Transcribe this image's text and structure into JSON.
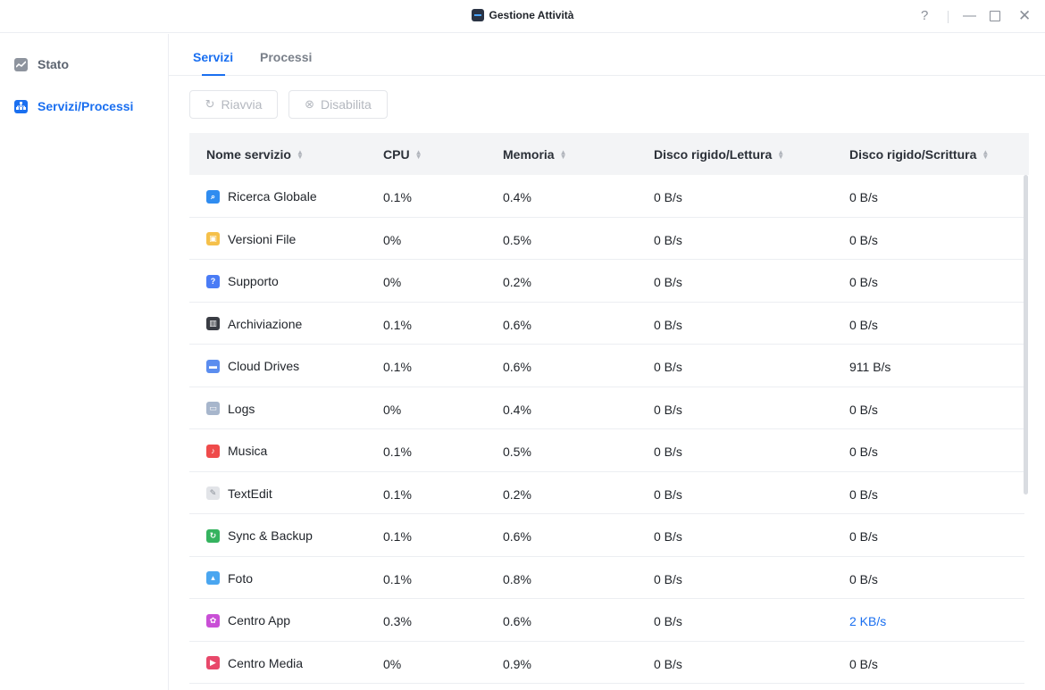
{
  "window": {
    "title": "Gestione Attività",
    "help": "?",
    "minimize": "—",
    "close": "✕"
  },
  "sidebar": {
    "items": [
      {
        "label": "Stato",
        "icon": "chart-line-icon"
      },
      {
        "label": "Servizi/Processi",
        "icon": "hierarchy-icon"
      }
    ]
  },
  "tabs": [
    {
      "label": "Servizi"
    },
    {
      "label": "Processi"
    }
  ],
  "toolbar": {
    "restart_label": "Riavvia",
    "disable_label": "Disabilita"
  },
  "table": {
    "headers": [
      "Nome servizio",
      "CPU",
      "Memoria",
      "Disco rigido/Lettura",
      "Disco rigido/Scrittura"
    ],
    "rows": [
      {
        "name": "Ricerca Globale",
        "cpu": "0.1%",
        "mem": "0.4%",
        "read": "0 B/s",
        "write": "0 B/s",
        "icon": "search-icon",
        "color": "#2f8cf0"
      },
      {
        "name": "Versioni File",
        "cpu": "0%",
        "mem": "0.5%",
        "read": "0 B/s",
        "write": "0 B/s",
        "icon": "file-versions-icon",
        "color": "#f5c04a"
      },
      {
        "name": "Supporto",
        "cpu": "0%",
        "mem": "0.2%",
        "read": "0 B/s",
        "write": "0 B/s",
        "icon": "question-icon",
        "color": "#4a7cf5"
      },
      {
        "name": "Archiviazione",
        "cpu": "0.1%",
        "mem": "0.6%",
        "read": "0 B/s",
        "write": "0 B/s",
        "icon": "storage-icon",
        "color": "#3a3d44"
      },
      {
        "name": "Cloud Drives",
        "cpu": "0.1%",
        "mem": "0.6%",
        "read": "0 B/s",
        "write": "911 B/s",
        "icon": "cloud-drive-icon",
        "color": "#5b8def"
      },
      {
        "name": "Logs",
        "cpu": "0%",
        "mem": "0.4%",
        "read": "0 B/s",
        "write": "0 B/s",
        "icon": "logs-icon",
        "color": "#a7b6cc"
      },
      {
        "name": "Musica",
        "cpu": "0.1%",
        "mem": "0.5%",
        "read": "0 B/s",
        "write": "0 B/s",
        "icon": "music-icon",
        "color": "#ef4b4b"
      },
      {
        "name": "TextEdit",
        "cpu": "0.1%",
        "mem": "0.2%",
        "read": "0 B/s",
        "write": "0 B/s",
        "icon": "text-edit-icon",
        "color": "#e2e4e8"
      },
      {
        "name": "Sync & Backup",
        "cpu": "0.1%",
        "mem": "0.6%",
        "read": "0 B/s",
        "write": "0 B/s",
        "icon": "sync-icon",
        "color": "#35b35f"
      },
      {
        "name": "Foto",
        "cpu": "0.1%",
        "mem": "0.8%",
        "read": "0 B/s",
        "write": "0 B/s",
        "icon": "photo-icon",
        "color": "#4aa6f0"
      },
      {
        "name": "Centro App",
        "cpu": "0.3%",
        "mem": "0.6%",
        "read": "0 B/s",
        "write": "2 KB/s",
        "icon": "app-center-icon",
        "color": "#c94fd6"
      },
      {
        "name": "Centro Media",
        "cpu": "0%",
        "mem": "0.9%",
        "read": "0 B/s",
        "write": "0 B/s",
        "icon": "media-center-icon",
        "color": "#e8486a"
      }
    ]
  }
}
